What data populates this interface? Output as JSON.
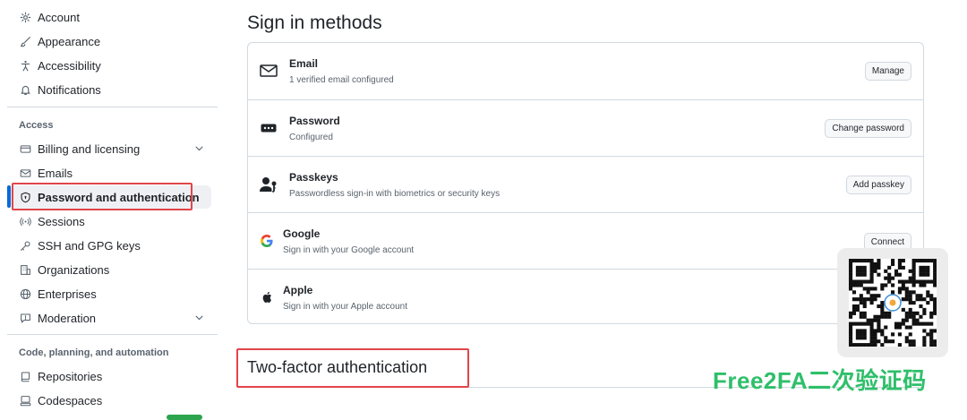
{
  "sidebar": {
    "items_top": [
      {
        "label": "Account",
        "icon": "gear-icon"
      },
      {
        "label": "Appearance",
        "icon": "paintbrush-icon"
      },
      {
        "label": "Accessibility",
        "icon": "accessibility-icon"
      },
      {
        "label": "Notifications",
        "icon": "bell-icon"
      }
    ],
    "access_heading": "Access",
    "items_access": [
      {
        "label": "Billing and licensing",
        "icon": "credit-card-icon"
      },
      {
        "label": "Emails",
        "icon": "mail-icon"
      },
      {
        "label": "Password and authentication",
        "icon": "shield-lock-icon"
      },
      {
        "label": "Sessions",
        "icon": "broadcast-icon"
      },
      {
        "label": "SSH and GPG keys",
        "icon": "key-icon"
      },
      {
        "label": "Organizations",
        "icon": "organization-icon"
      },
      {
        "label": "Enterprises",
        "icon": "globe-icon"
      },
      {
        "label": "Moderation",
        "icon": "report-icon"
      }
    ],
    "code_heading": "Code, planning, and automation",
    "items_code": [
      {
        "label": "Repositories",
        "icon": "repo-icon"
      },
      {
        "label": "Codespaces",
        "icon": "codespaces-icon"
      }
    ]
  },
  "main": {
    "title": "Sign in methods",
    "methods": [
      {
        "title": "Email",
        "subtitle": "1 verified email configured",
        "button": "Manage",
        "icon": "mail-icon"
      },
      {
        "title": "Password",
        "subtitle": "Configured",
        "button": "Change password",
        "icon": "password-icon"
      },
      {
        "title": "Passkeys",
        "subtitle": "Passwordless sign-in with biometrics or security keys",
        "button": "Add passkey",
        "icon": "passkey-icon"
      },
      {
        "title": "Google",
        "subtitle": "Sign in with your Google account",
        "button": "Connect",
        "icon": "google-icon"
      },
      {
        "title": "Apple",
        "subtitle": "Sign in with your Apple account",
        "button": "",
        "icon": "apple-icon"
      }
    ],
    "tfa_title": "Two-factor authentication"
  },
  "watermark": {
    "text": "Free2FA二次验证码",
    "color": "#2fbf6a"
  },
  "colors": {
    "accent": "#0969da",
    "highlight": "#e0454a"
  }
}
